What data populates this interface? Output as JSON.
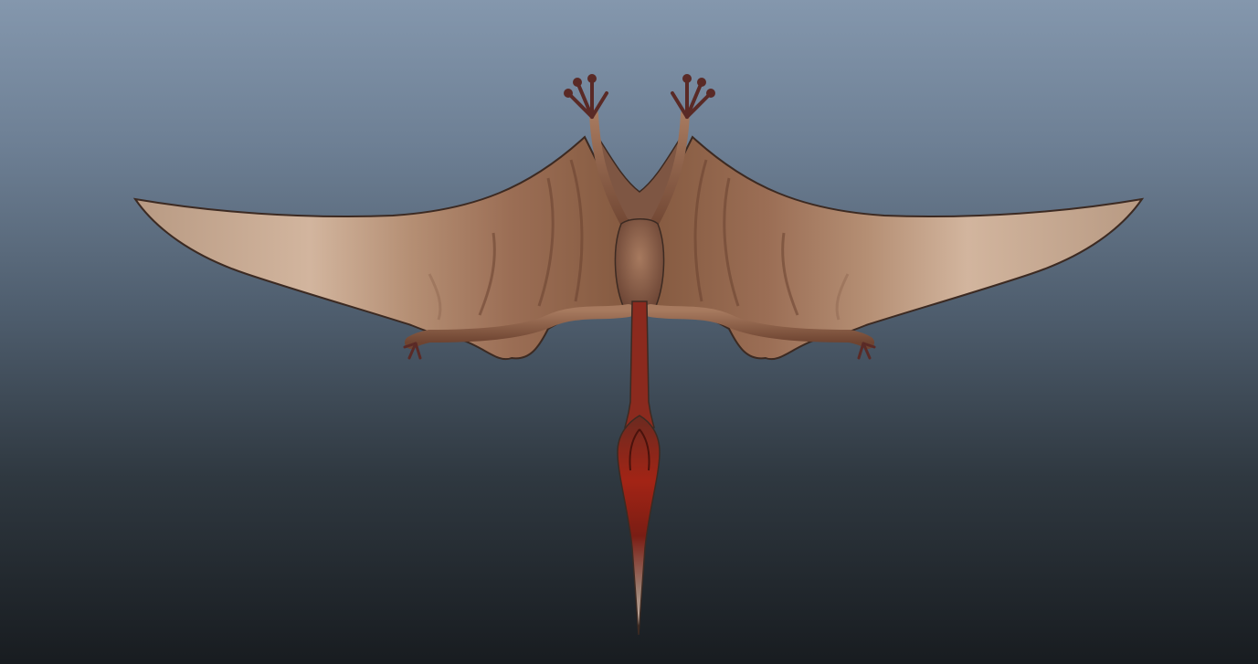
{
  "viewport": {
    "background_top": "#8497ad",
    "background_bottom": "#181c20"
  },
  "model": {
    "subject": "pterosaur",
    "view": "underside",
    "colors": {
      "membrane_light": "#c7a78c",
      "membrane_dark": "#8c6248",
      "bone": "#7d5340",
      "bone_highlight": "#a77a5f",
      "beak_red": "#8f1d14",
      "beak_tip": "#b09c8f",
      "claw": "#5a2a26"
    }
  }
}
